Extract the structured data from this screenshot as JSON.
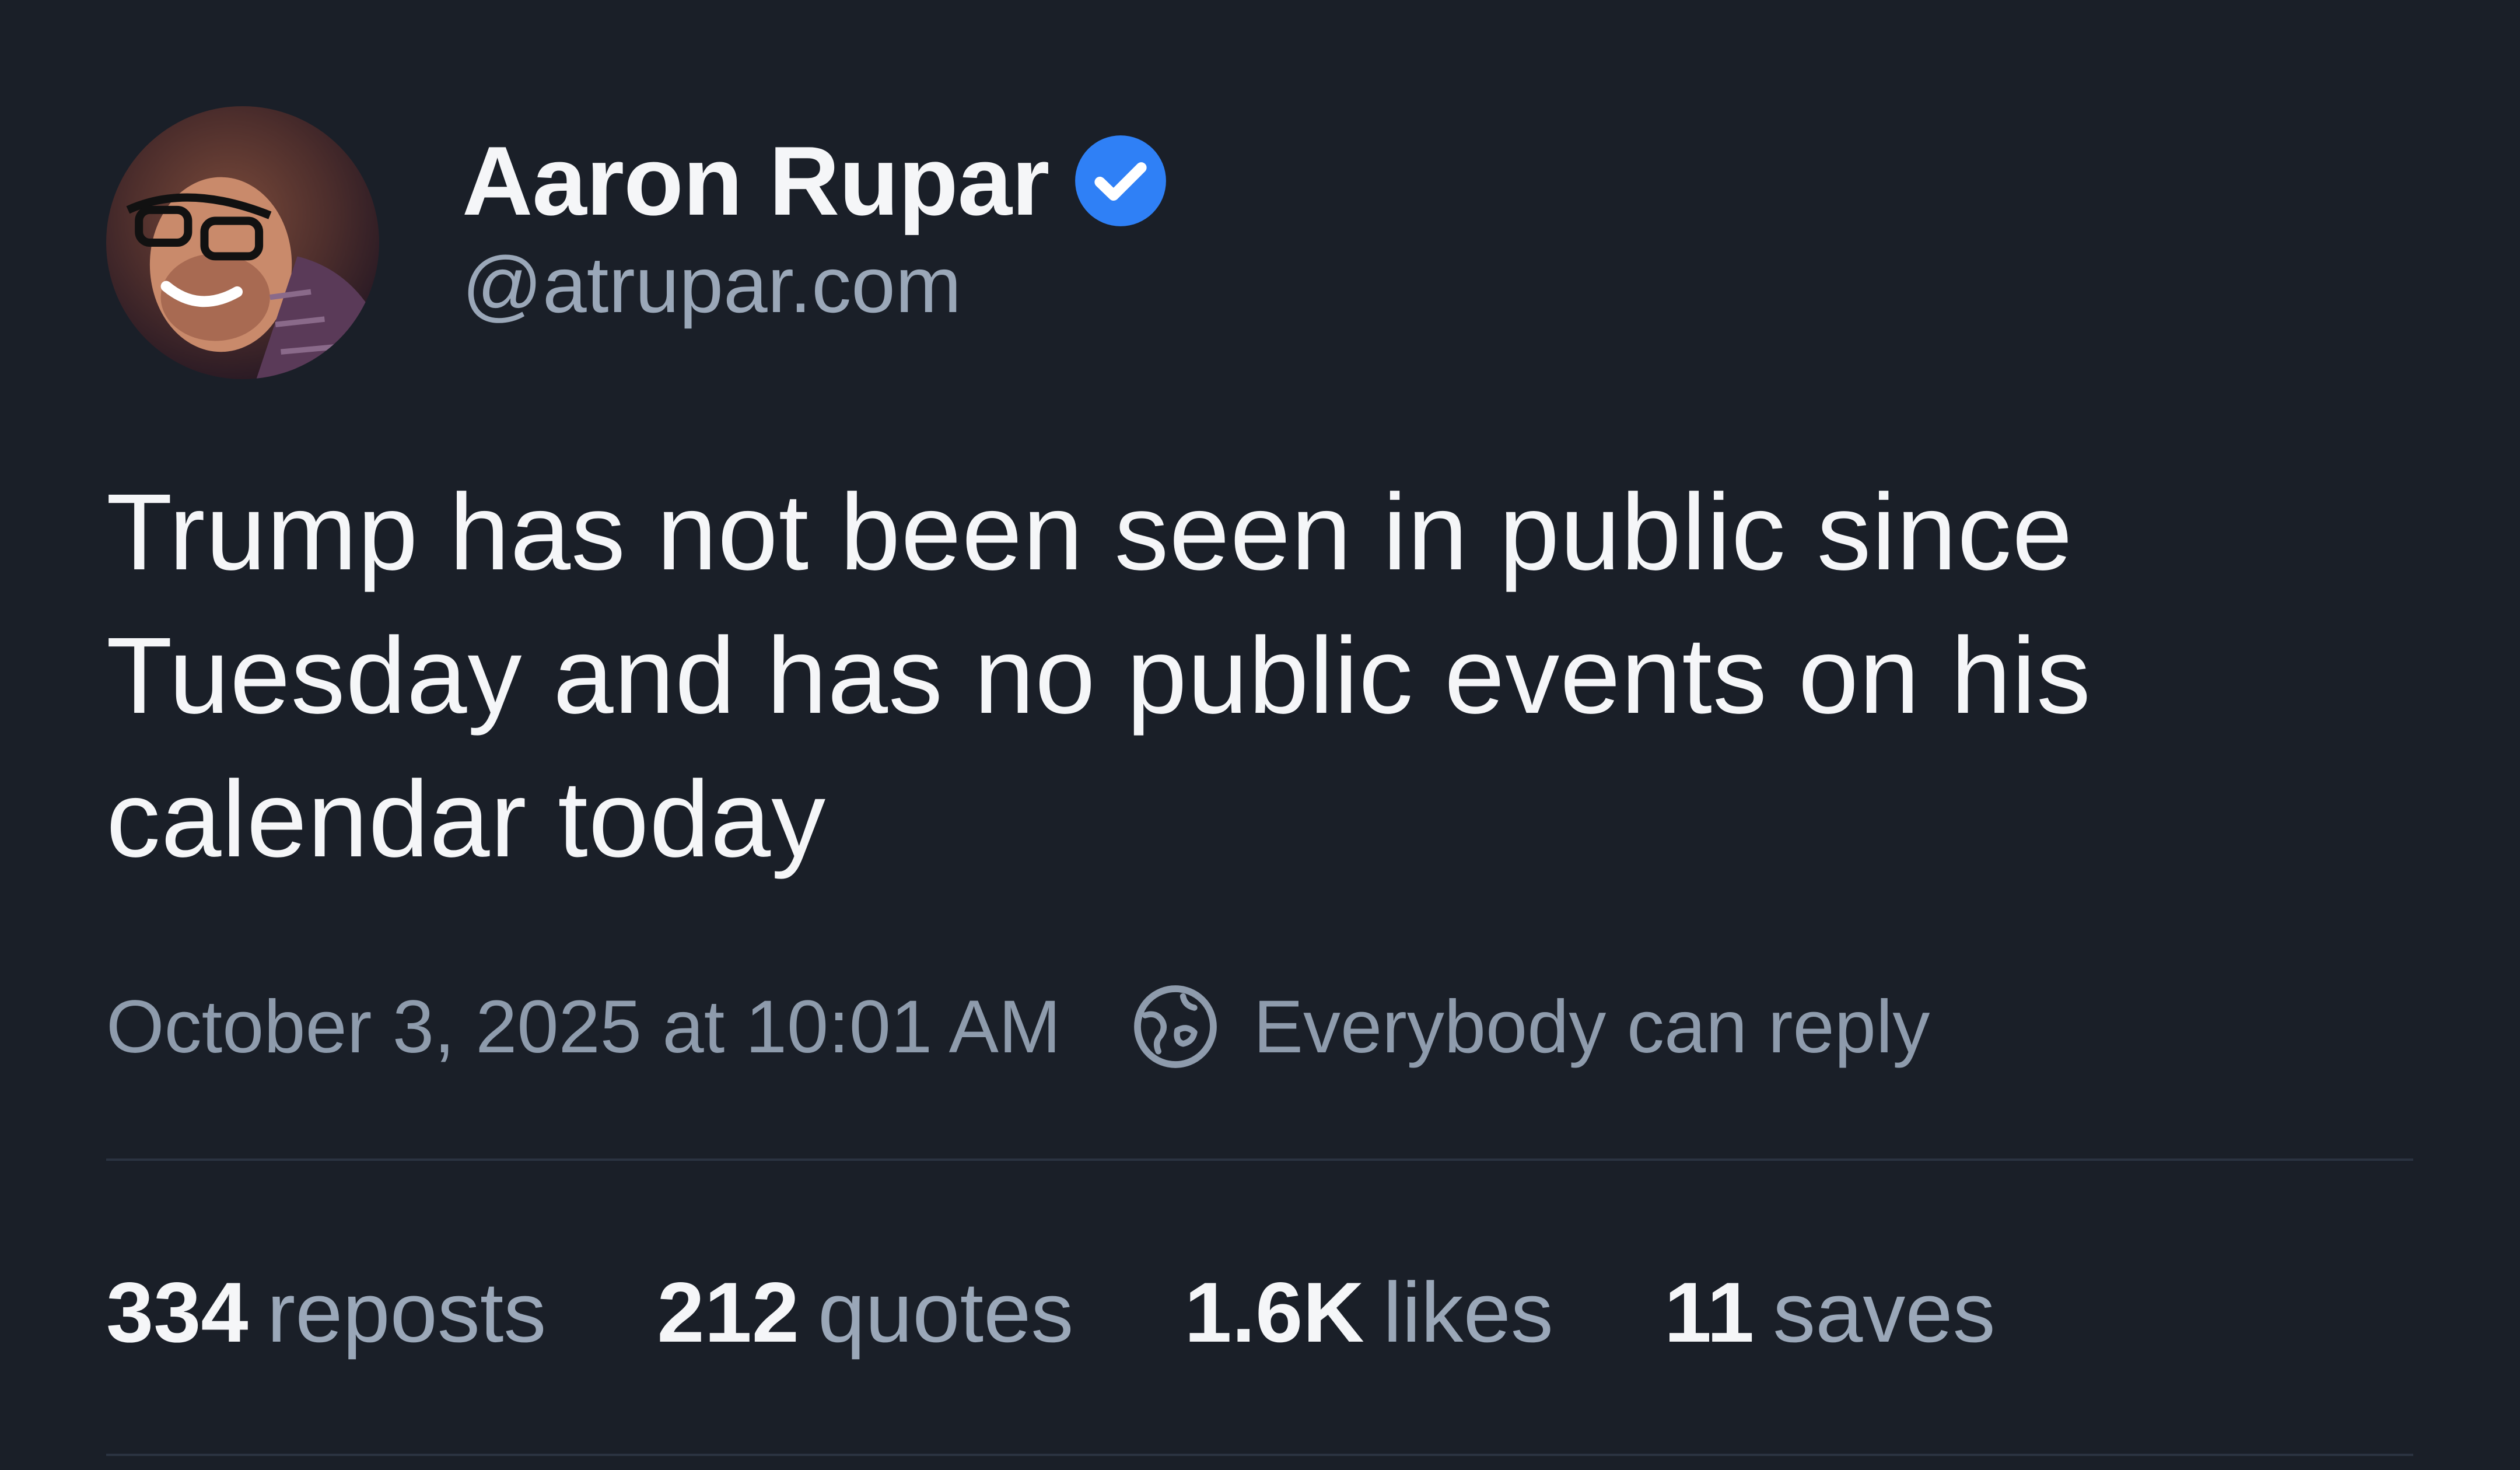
{
  "author": {
    "display_name": "Aaron Rupar",
    "handle": "@atrupar.com",
    "verified": true,
    "verified_color": "#2f80f6",
    "avatar_icon": "profile-photo"
  },
  "post": {
    "text": "Trump has not been seen in public since Tuesday and has no public events on his calendar today",
    "timestamp": "October 3, 2025 at 10:01 AM",
    "reply_setting": "Everybody can reply",
    "reply_icon": "globe-icon"
  },
  "stats": [
    {
      "count": "334",
      "label": "reposts"
    },
    {
      "count": "212",
      "label": "quotes"
    },
    {
      "count": "1.6K",
      "label": "likes"
    },
    {
      "count": "11",
      "label": "saves"
    }
  ],
  "colors": {
    "background": "#1a1f28",
    "primary_text": "#f5f6f8",
    "secondary_text": "#9aa7b8",
    "divider": "#2b3341"
  }
}
